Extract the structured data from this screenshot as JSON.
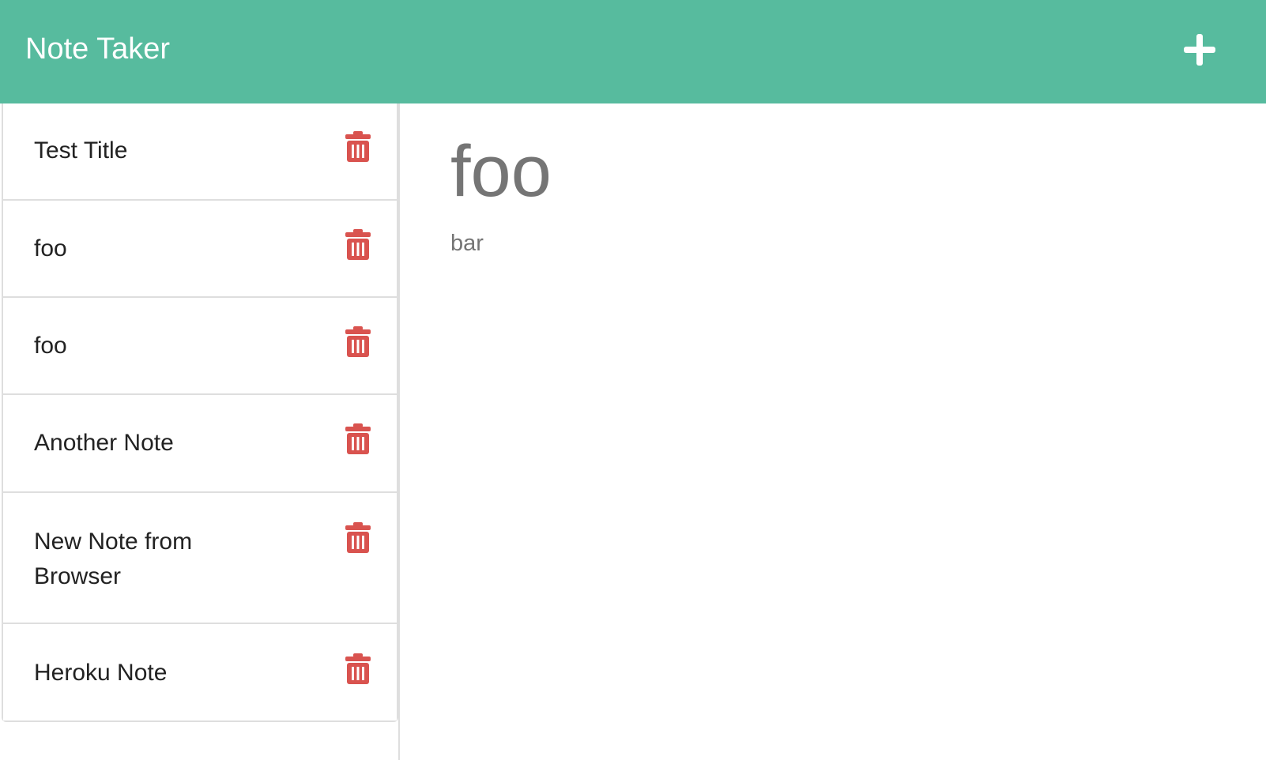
{
  "header": {
    "brand": "Note Taker",
    "new_note_icon": "plus-icon"
  },
  "colors": {
    "navbar": "#57bb9e",
    "delete_icon": "#d9534f",
    "view_text": "#757575"
  },
  "notes": [
    {
      "title": "Test Title",
      "delete_icon": "trash-icon"
    },
    {
      "title": "foo",
      "delete_icon": "trash-icon"
    },
    {
      "title": "foo",
      "delete_icon": "trash-icon"
    },
    {
      "title": "Another Note",
      "delete_icon": "trash-icon"
    },
    {
      "title": "New Note from Browser",
      "delete_icon": "trash-icon"
    },
    {
      "title": "Heroku Note",
      "delete_icon": "trash-icon"
    }
  ],
  "active_note": {
    "title": "foo",
    "text": "bar"
  }
}
